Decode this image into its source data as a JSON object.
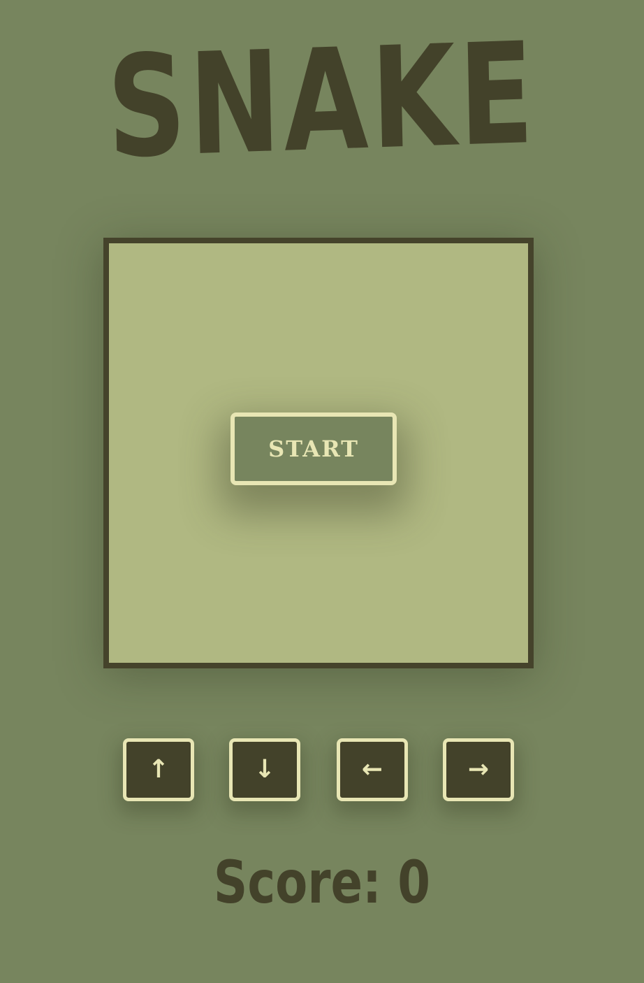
{
  "title": "SNAKE",
  "start_button": {
    "label": "START"
  },
  "controls": [
    {
      "name": "up",
      "label": "↑"
    },
    {
      "name": "down",
      "label": "↓"
    },
    {
      "name": "left",
      "label": "←"
    },
    {
      "name": "right",
      "label": "→"
    }
  ],
  "score": {
    "label": "Score: 0"
  },
  "colors": {
    "background": "#77855e",
    "board": "#b0b882",
    "dark": "#43422a",
    "light": "#e8e6b4"
  }
}
